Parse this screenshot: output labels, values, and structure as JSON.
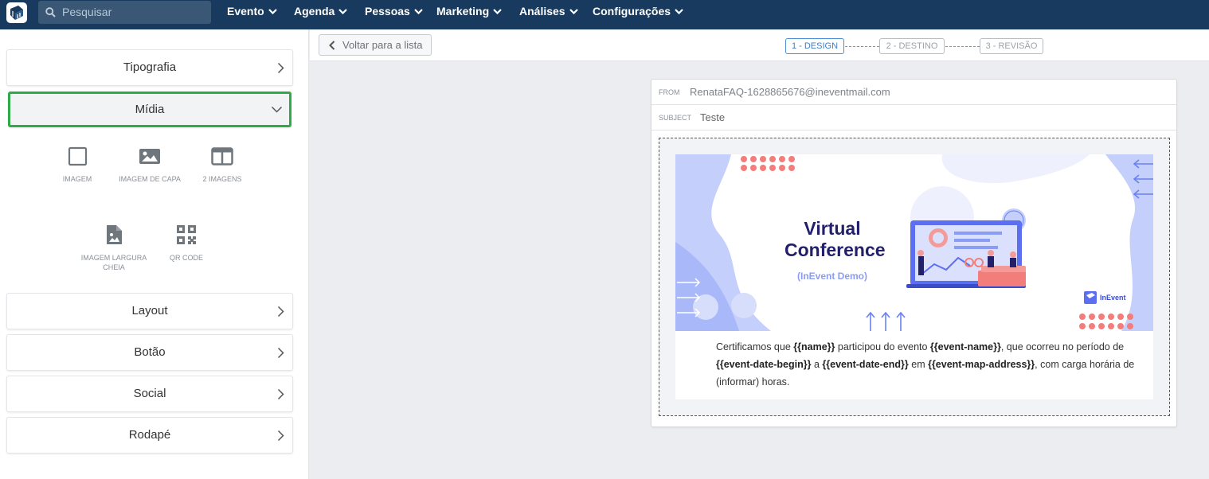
{
  "topbar": {
    "logo": "inevent-logo-icon",
    "search_placeholder": "Pesquisar",
    "nav": [
      {
        "label": "Evento"
      },
      {
        "label": "Agenda"
      },
      {
        "label": "Pessoas"
      },
      {
        "label": "Marketing"
      },
      {
        "label": "Análises"
      },
      {
        "label": "Configurações"
      }
    ]
  },
  "sidebar": {
    "sections": {
      "tipografia": "Tipografia",
      "midia": "Mídia",
      "layout": "Layout",
      "botao": "Botão",
      "social": "Social",
      "rodape": "Rodapé"
    },
    "media_items": {
      "imagem": "IMAGEM",
      "imagem_capa": "IMAGEM DE CAPA",
      "duas_imagens": "2 IMAGENS",
      "imagem_largura_linha1": "IMAGEM LARGURA",
      "imagem_largura_linha2": "CHEIA",
      "qr_code": "QR CODE"
    }
  },
  "toolbar": {
    "back_label": "Voltar para a lista",
    "steps": [
      "1 - DESIGN",
      "2 - DESTINO",
      "3 - REVISÃO"
    ],
    "active_step": 1
  },
  "email": {
    "from_key": "FROM",
    "from_value": "RenataFAQ-1628865676@ineventmail.com",
    "subject_key": "SUBJECT",
    "subject_value": "Teste",
    "banner": {
      "title_line1": "Virtual",
      "title_line2": "Conference",
      "subtitle": "(InEvent Demo)",
      "brand": "InEvent",
      "colors": {
        "title": "#23206b",
        "accent": "#8b9cf4",
        "dots": "#f37d7a"
      }
    },
    "body": {
      "l1_a": "Certificamos que ",
      "l1_b": "{{name}}",
      "l1_c": " participou do evento ",
      "l1_d": "{{event-name}}",
      "l1_e": ", que ocorreu no período de",
      "l2_a": "{{event-date-begin}}",
      "l2_b": " a ",
      "l2_c": "{{event-date-end}}",
      "l2_d": " em ",
      "l2_e": "{{event-map-address}}",
      "l2_f": ", com carga horária de",
      "l3": "(informar) horas."
    }
  },
  "colors": {
    "nav_bg": "#173a5e",
    "highlight": "#2eaa48",
    "step_active": "#3b7fc6"
  }
}
